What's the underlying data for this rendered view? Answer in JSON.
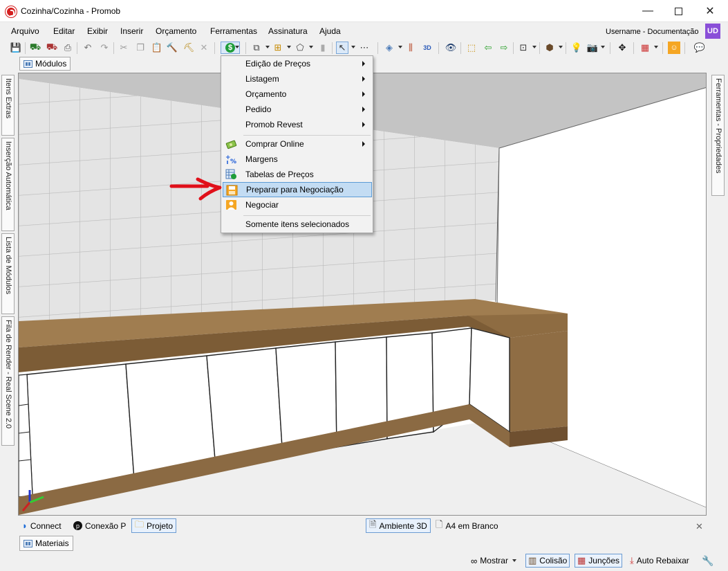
{
  "window": {
    "title": "Cozinha/Cozinha - Promob",
    "minimize": "—",
    "close": "✕"
  },
  "menu": {
    "items": [
      "Arquivo",
      "Editar",
      "Exibir",
      "Inserir",
      "Orçamento",
      "Ferramentas",
      "Assinatura",
      "Ajuda"
    ],
    "user_label": "Username - Documentação",
    "user_initials": "UD"
  },
  "tabs": {
    "modulos": "Módulos",
    "materiais": "Materiais"
  },
  "side_panels": {
    "left": [
      "Itens Extras",
      "Inserção Automática",
      "Lista de Módulos",
      "Fila de Render - Real Scene 2.0"
    ],
    "right": "Ferramentas - Propriedades"
  },
  "dropdown": {
    "items": [
      {
        "label": "Edição de Preços",
        "submenu": true
      },
      {
        "label": "Listagem",
        "submenu": true
      },
      {
        "label": "Orçamento",
        "submenu": true
      },
      {
        "label": "Pedido",
        "submenu": true
      },
      {
        "label": "Promob Revest",
        "submenu": true
      },
      {
        "label": "Comprar Online",
        "submenu": true,
        "icon": "cash-icon"
      },
      {
        "label": "Margens",
        "submenu": false,
        "icon": "percent-icon"
      },
      {
        "label": "Tabelas de Preços",
        "submenu": false,
        "icon": "price-table-icon"
      },
      {
        "label": "Preparar para Negociação",
        "submenu": false,
        "icon": "prepare-negotiation-icon",
        "highlighted": true
      },
      {
        "label": "Negociar",
        "submenu": false,
        "icon": "negotiate-icon"
      },
      {
        "label": "Somente itens selecionados",
        "submenu": false
      }
    ]
  },
  "bottom_tabs": {
    "connect": "Connect",
    "conexao": "Conexão P",
    "projeto": "Projeto",
    "ambiente": "Ambiente 3D",
    "a4": "A4 em Branco",
    "close": "✕"
  },
  "status_bar": {
    "mostrar": "Mostrar",
    "colisao": "Colisão",
    "juncoes": "Junções",
    "auto_rebaixar": "Auto Rebaixar"
  },
  "colors": {
    "highlight": "#c3dcf3",
    "countertop": "#8b6a43",
    "accent_red": "#e0101a"
  }
}
